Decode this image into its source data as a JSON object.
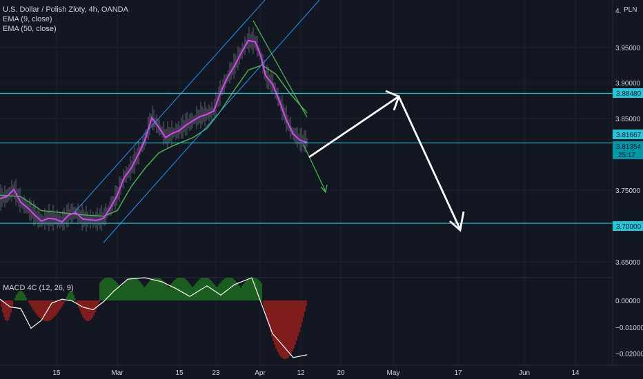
{
  "legend": {
    "symbol": "U.S. Dollar / Polish Zloty, 4h, OANDA",
    "ema9": "EMA (9, close)",
    "ema50": "EMA (50, close)",
    "macd": "MACD 4C (12, 26, 9)"
  },
  "currency": "PLN",
  "countdown": "25:17",
  "colors": {
    "background": "#131722",
    "hline": "#26c6da",
    "channel": "#2196f3",
    "ema9": "#e040fb",
    "ema50": "#4caf50",
    "arrow": "#ffffff",
    "macd_pos": "#1b5e20",
    "macd_neg": "#7f1d1d"
  },
  "chart_data": {
    "type": "line",
    "title": "U.S. Dollar / Polish Zloty, 4h, OANDA",
    "price_axis": {
      "ticks": [
        "3.95000",
        "3.90000",
        "3.85000",
        "3.75000",
        "3.65000"
      ],
      "top_tick_partial": "4.",
      "ylim": [
        3.615,
        4.002
      ]
    },
    "time_axis": {
      "labels": [
        "15",
        "Mar",
        "15",
        "23",
        "Apr",
        "12",
        "20",
        "May",
        "17",
        "Jun",
        "14"
      ]
    },
    "price_labels": [
      {
        "value": "3.88480",
        "kind": "horizontal-line"
      },
      {
        "value": "3.81667",
        "kind": "horizontal-line"
      },
      {
        "value": "3.81354",
        "kind": "last-price"
      },
      {
        "value": "3.70000",
        "kind": "horizontal-line"
      }
    ],
    "horizontal_lines": [
      3.8848,
      3.8143,
      3.7
    ],
    "macd_axis": {
      "ticks": [
        "0.00000",
        "−0.01000",
        "−0.02000"
      ],
      "ylim": [
        -0.0225,
        0.0074
      ]
    },
    "series": [
      {
        "name": "EMA (9, close)",
        "points": [
          [
            0,
            3.735
          ],
          [
            10,
            3.738
          ],
          [
            20,
            3.748
          ],
          [
            30,
            3.73
          ],
          [
            40,
            3.722
          ],
          [
            50,
            3.712
          ],
          [
            60,
            3.703
          ],
          [
            70,
            3.707
          ],
          [
            80,
            3.706
          ],
          [
            90,
            3.702
          ],
          [
            100,
            3.712
          ],
          [
            110,
            3.715
          ],
          [
            120,
            3.706
          ],
          [
            130,
            3.705
          ],
          [
            140,
            3.704
          ],
          [
            150,
            3.707
          ],
          [
            160,
            3.722
          ],
          [
            170,
            3.74
          ],
          [
            180,
            3.765
          ],
          [
            190,
            3.778
          ],
          [
            200,
            3.797
          ],
          [
            210,
            3.818
          ],
          [
            220,
            3.85
          ],
          [
            230,
            3.837
          ],
          [
            240,
            3.822
          ],
          [
            250,
            3.828
          ],
          [
            260,
            3.832
          ],
          [
            270,
            3.84
          ],
          [
            280,
            3.846
          ],
          [
            290,
            3.852
          ],
          [
            300,
            3.855
          ],
          [
            310,
            3.86
          ],
          [
            320,
            3.887
          ],
          [
            330,
            3.908
          ],
          [
            340,
            3.924
          ],
          [
            350,
            3.943
          ],
          [
            360,
            3.96
          ],
          [
            370,
            3.958
          ],
          [
            378,
            3.938
          ],
          [
            385,
            3.91
          ],
          [
            395,
            3.898
          ],
          [
            405,
            3.874
          ],
          [
            415,
            3.847
          ],
          [
            425,
            3.827
          ],
          [
            435,
            3.818
          ],
          [
            445,
            3.815
          ]
        ]
      },
      {
        "name": "EMA (50, close)",
        "points": [
          [
            0,
            3.74
          ],
          [
            30,
            3.738
          ],
          [
            60,
            3.718
          ],
          [
            90,
            3.715
          ],
          [
            120,
            3.712
          ],
          [
            150,
            3.71
          ],
          [
            170,
            3.718
          ],
          [
            190,
            3.752
          ],
          [
            210,
            3.778
          ],
          [
            230,
            3.8
          ],
          [
            250,
            3.81
          ],
          [
            280,
            3.822
          ],
          [
            300,
            3.835
          ],
          [
            320,
            3.86
          ],
          [
            340,
            3.89
          ],
          [
            360,
            3.918
          ],
          [
            380,
            3.925
          ],
          [
            400,
            3.912
          ],
          [
            420,
            3.885
          ],
          [
            445,
            3.857
          ]
        ]
      }
    ],
    "macd": {
      "histogram": [
        {
          "from": 0,
          "to": 20,
          "sign": "-"
        },
        {
          "from": 20,
          "to": 40,
          "sign": "+"
        },
        {
          "from": 40,
          "to": 95,
          "sign": "-"
        },
        {
          "from": 95,
          "to": 110,
          "sign": "+"
        },
        {
          "from": 110,
          "to": 145,
          "sign": "-"
        },
        {
          "from": 145,
          "to": 380,
          "sign": "+"
        },
        {
          "from": 380,
          "to": 446,
          "sign": "-"
        }
      ],
      "macd_line": [
        [
          0,
          0.0005
        ],
        [
          15,
          -0.0025
        ],
        [
          30,
          -0.003
        ],
        [
          45,
          -0.0105
        ],
        [
          60,
          -0.0075
        ],
        [
          75,
          -0.001
        ],
        [
          90,
          0.0005
        ],
        [
          105,
          -0.0002
        ],
        [
          120,
          -0.0025
        ],
        [
          135,
          -0.0035
        ],
        [
          150,
          -0.0005
        ],
        [
          165,
          0.0035
        ],
        [
          185,
          0.008
        ],
        [
          210,
          0.01
        ],
        [
          235,
          0.007
        ],
        [
          255,
          0.0045
        ],
        [
          275,
          0.0015
        ],
        [
          300,
          0.0055
        ],
        [
          320,
          0.002
        ],
        [
          340,
          0.006
        ],
        [
          365,
          0.009
        ],
        [
          380,
          -0.002
        ],
        [
          395,
          -0.0125
        ],
        [
          410,
          -0.017
        ],
        [
          425,
          -0.0215
        ],
        [
          445,
          -0.0205
        ]
      ]
    }
  }
}
